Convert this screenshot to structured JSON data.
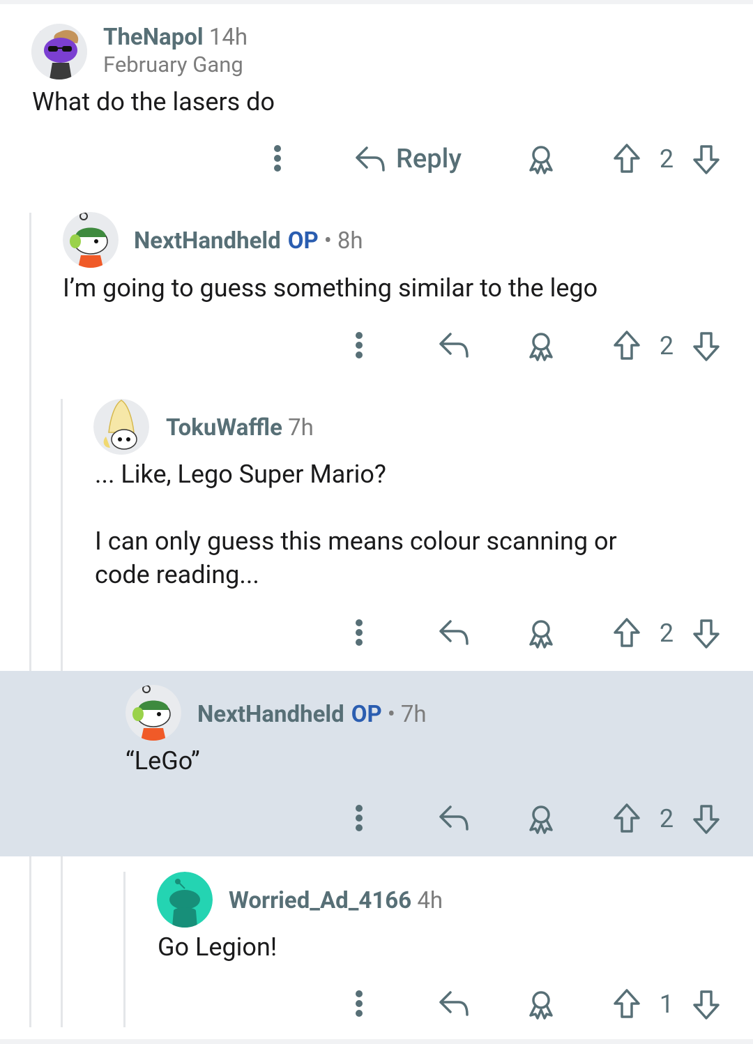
{
  "comments": [
    {
      "username": "TheNapol",
      "time": "14h",
      "flair": "February Gang",
      "op": "",
      "body": "What do the lasers do",
      "reply_label": "Reply",
      "score": "2",
      "avatar": "purple-snoo-sunglasses"
    },
    {
      "username": "NextHandheld",
      "op": "OP",
      "separator": "•",
      "time": "8h",
      "body": "I’m going to guess something similar to the lego",
      "score": "2",
      "avatar": "snoo-headphones"
    },
    {
      "username": "TokuWaffle",
      "time": "7h",
      "body": "... Like, Lego Super Mario?\n\nI can only guess this means colour scanning or\ncode reading...",
      "score": "2",
      "avatar": "snoo-cone-hat"
    },
    {
      "username": "NextHandheld",
      "op": "OP",
      "separator": "•",
      "time": "7h",
      "body": "“LeGo”",
      "score": "2",
      "avatar": "snoo-headphones"
    },
    {
      "username": "Worried_Ad_4166",
      "time": "4h",
      "body": "Go Legion!",
      "score": "1",
      "avatar": "default-teal-snoo"
    }
  ],
  "colors": {
    "highlight_bg": "#dbe2ea",
    "username": "#576f76",
    "op": "#2a5db0",
    "action": "#576f76"
  }
}
